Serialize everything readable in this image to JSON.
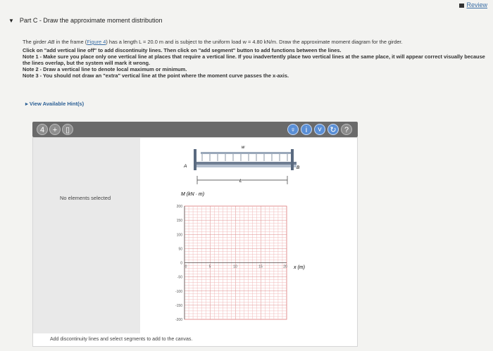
{
  "header": {
    "review_label": "Review"
  },
  "part": {
    "title": "Part C - Draw the approximate moment distribution"
  },
  "problem": {
    "intro_a": "The girder ",
    "intro_b": "AB",
    "intro_c": " in the frame (",
    "intro_link": "Figure 4",
    "intro_d": ") has a length L = 20.0 m and is subject to the uniform load w = 4.80 kN/m. Draw the approximate moment diagram for the girder.",
    "line2": "Click on \"add vertical line off\" to add discontinuity lines. Then click on \"add segment\" button to add functions between the lines.",
    "note1": "Note 1 - Make sure you place only one vertical line at places that require a vertical line. If you inadvertently place two vertical lines at the same place, it will appear correct visually because the lines overlap, but the system will mark it wrong.",
    "note2": "Note 2 - Draw a vertical line to denote local maximum or minimum.",
    "note3": "Note 3 - You should not draw an \"extra\" vertical line at the point where the moment curve passes the x-axis."
  },
  "hint": {
    "label": "View Available Hint(s)"
  },
  "toolbar": {
    "left": [
      {
        "name": "add-vertical-line-icon",
        "glyph": "4"
      },
      {
        "name": "add-segment-icon",
        "glyph": "+"
      },
      {
        "name": "delete-icon",
        "glyph": "▯"
      }
    ],
    "right": [
      {
        "name": "hint-bulb-icon",
        "glyph": "♀"
      },
      {
        "name": "info-icon",
        "glyph": "i"
      },
      {
        "name": "chevron-down-icon",
        "glyph": "˅"
      },
      {
        "name": "reset-icon",
        "glyph": "↻"
      },
      {
        "name": "help-icon",
        "glyph": "?"
      }
    ]
  },
  "side_panel": {
    "text": "No elements selected"
  },
  "beam": {
    "load_label": "w",
    "left_label": "A",
    "right_label": "B",
    "length_label": "L"
  },
  "chart": {
    "ylabel": "M (kN · m)",
    "xlabel": "x (m)",
    "y_ticks": [
      "200",
      "150",
      "100",
      "50",
      "0",
      "-50",
      "-100",
      "-150",
      "-200"
    ],
    "x_ticks": [
      "0",
      "5",
      "10",
      "15",
      "20"
    ]
  },
  "status": {
    "text": "Add discontinuity lines and select segments to add to the canvas."
  }
}
